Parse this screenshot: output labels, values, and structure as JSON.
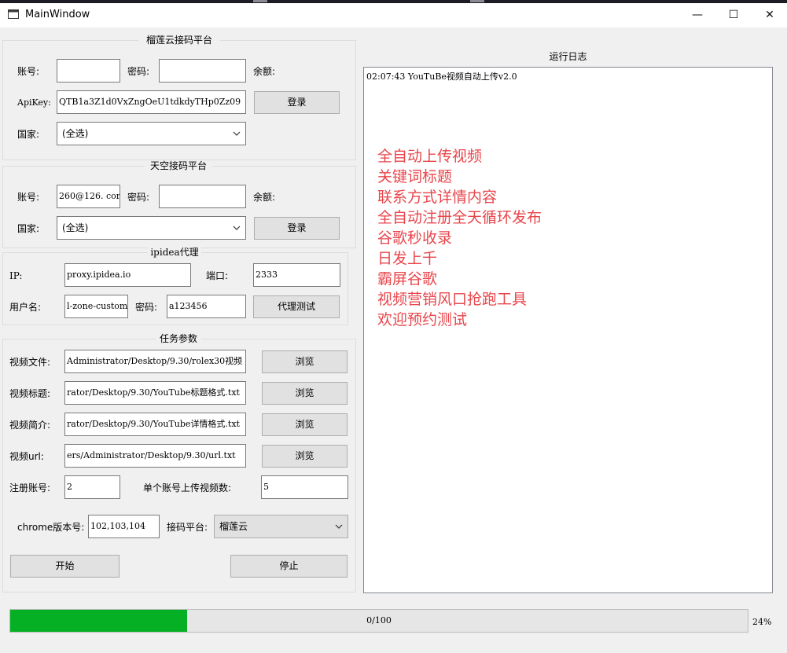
{
  "window": {
    "title": "MainWindow",
    "minimize_glyph": "—",
    "maximize_glyph": "☐",
    "close_glyph": "✕"
  },
  "liulian": {
    "title": "榴莲云接码平台",
    "account_label": "账号:",
    "account_value": "",
    "password_label": "密码:",
    "password_value": "",
    "balance_label": "余额:",
    "apikey_label": "ApiKey:",
    "apikey_value": "QTB1a3Z1d0VxZngOeU1tdkdyTHp0Zz09",
    "login_label": "登录",
    "country_label": "国家:",
    "country_value": "(全选)"
  },
  "tiankong": {
    "title": "天空接码平台",
    "account_label": "账号:",
    "account_value": "260@126. com",
    "password_label": "密码:",
    "password_value": "",
    "balance_label": "余额:",
    "country_label": "国家:",
    "country_value": "(全选)",
    "login_label": "登录"
  },
  "proxy": {
    "title": "ipidea代理",
    "ip_label": "IP:",
    "ip_value": "proxy.ipidea.io",
    "port_label": "端口:",
    "port_value": "2333",
    "user_label": "用户名:",
    "user_value": "l-zone-custom",
    "password_label": "密码:",
    "password_value": "a123456",
    "test_label": "代理测试"
  },
  "task": {
    "title": "任务参数",
    "video_file_label": "视频文件:",
    "video_file_value": "Administrator/Desktop/9.30/rolex30视频",
    "video_title_label": "视频标题:",
    "video_title_value": "rator/Desktop/9.30/YouTube标题格式.txt",
    "video_desc_label": "视频简介:",
    "video_desc_value": "rator/Desktop/9.30/YouTube详情格式.txt",
    "video_url_label": "视频url:",
    "video_url_value": "ers/Administrator/Desktop/9.30/url.txt",
    "browse_label": "浏览",
    "register_label": "注册账号:",
    "register_value": "2",
    "per_account_label": "单个账号上传视频数:",
    "per_account_value": "5",
    "chrome_label": "chrome版本号:",
    "chrome_value": "102,103,104",
    "platform_label": "接码平台:",
    "platform_value": "榴莲云",
    "start_label": "开始",
    "stop_label": "停止"
  },
  "log": {
    "title": "运行日志",
    "first_line": "02:07:43 YouTuBe视频自动上传v2.0",
    "promo_lines": [
      "全自动上传视频",
      "关键词标题",
      "联系方式详情内容",
      "全自动注册全天循环发布",
      "谷歌秒收录",
      "日发上千",
      "霸屏谷歌",
      "视频营销风口抢跑工具",
      "欢迎预约测试"
    ]
  },
  "progress": {
    "text": "0/100",
    "percent_label": "24%",
    "value": 0.24,
    "fill_color": "#06b025"
  }
}
